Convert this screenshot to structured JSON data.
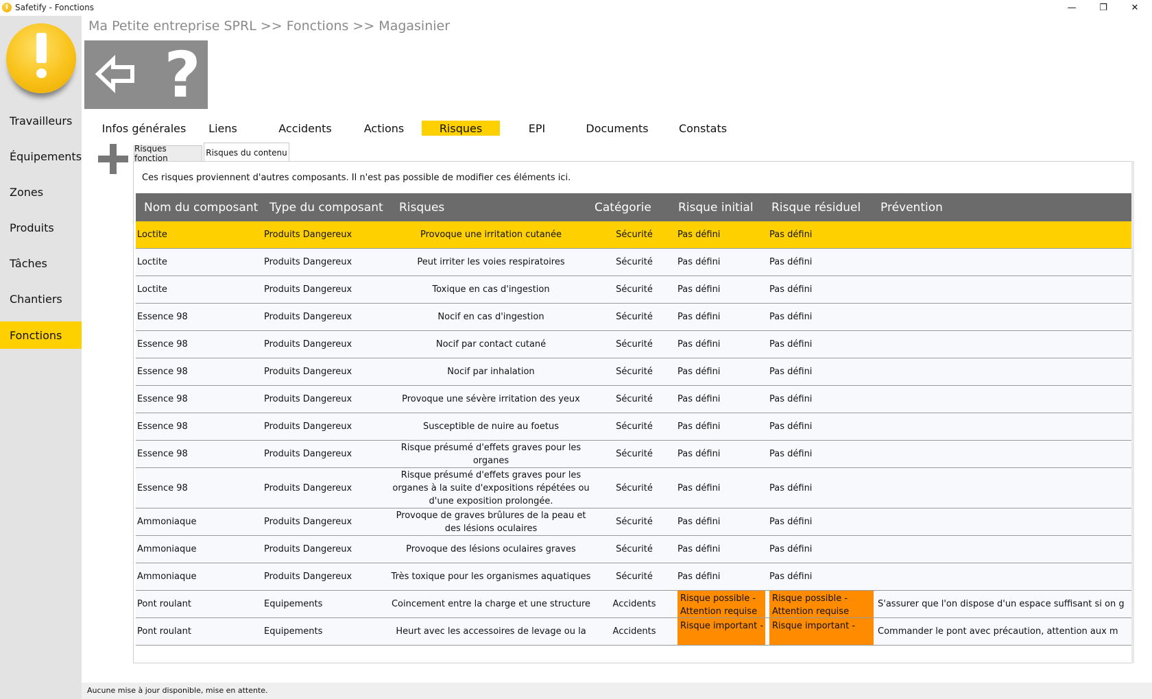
{
  "window": {
    "title": "Safetify - Fonctions",
    "minimize": "—",
    "maximize": "❐",
    "close": "✕"
  },
  "sidebar": {
    "items": [
      {
        "label": "Travailleurs",
        "active": false
      },
      {
        "label": "Équipements",
        "active": false
      },
      {
        "label": "Zones",
        "active": false
      },
      {
        "label": "Produits",
        "active": false
      },
      {
        "label": "Tâches",
        "active": false
      },
      {
        "label": "Chantiers",
        "active": false
      },
      {
        "label": "Fonctions",
        "active": true
      }
    ]
  },
  "breadcrumb": "Ma Petite entreprise SPRL >> Fonctions >> Magasinier",
  "toolbar": {
    "help_label": "?"
  },
  "tabs": [
    "Infos générales",
    "Liens",
    "Accidents",
    "Actions",
    "Risques",
    "EPI",
    "Documents",
    "Constats"
  ],
  "active_tab": "Risques",
  "subtabs": [
    "Risques fonction",
    "Risques du contenu"
  ],
  "note": "Ces risques proviennent d'autres composants. Il n'est pas possible de modifier ces éléments ici.",
  "table": {
    "headers": [
      "Nom du composant",
      "Type du composant",
      "Risques",
      "Catégorie",
      "Risque initial",
      "Risque résiduel",
      "Prévention"
    ],
    "rows": [
      [
        "Loctite",
        "Produits Dangereux",
        "Provoque une irritation cutanée",
        "Sécurité",
        "Pas défini",
        "Pas défini",
        ""
      ],
      [
        "Loctite",
        "Produits Dangereux",
        "Peut irriter les voies respiratoires",
        "Sécurité",
        "Pas défini",
        "Pas défini",
        ""
      ],
      [
        "Loctite",
        "Produits Dangereux",
        "Toxique en cas d'ingestion",
        "Sécurité",
        "Pas défini",
        "Pas défini",
        ""
      ],
      [
        "Essence 98",
        "Produits Dangereux",
        "Nocif en cas d'ingestion",
        "Sécurité",
        "Pas défini",
        "Pas défini",
        ""
      ],
      [
        "Essence 98",
        "Produits Dangereux",
        "Nocif par contact cutané",
        "Sécurité",
        "Pas défini",
        "Pas défini",
        ""
      ],
      [
        "Essence 98",
        "Produits Dangereux",
        "Nocif par inhalation",
        "Sécurité",
        "Pas défini",
        "Pas défini",
        ""
      ],
      [
        "Essence 98",
        "Produits Dangereux",
        "Provoque une sévère irritation des yeux",
        "Sécurité",
        "Pas défini",
        "Pas défini",
        ""
      ],
      [
        "Essence 98",
        "Produits Dangereux",
        "Susceptible de nuire au foetus",
        "Sécurité",
        "Pas défini",
        "Pas défini",
        ""
      ],
      [
        "Essence 98",
        "Produits Dangereux",
        "Risque présumé d'effets graves pour les organes",
        "Sécurité",
        "Pas défini",
        "Pas défini",
        ""
      ],
      [
        "Essence 98",
        "Produits Dangereux",
        "Risque présumé d'effets graves pour les organes à la suite d'expositions répétées ou d'une exposition prolongée.",
        "Sécurité",
        "Pas défini",
        "Pas défini",
        ""
      ],
      [
        "Ammoniaque",
        "Produits Dangereux",
        "Provoque de graves brûlures de la peau et des lésions oculaires",
        "Sécurité",
        "Pas défini",
        "Pas défini",
        ""
      ],
      [
        "Ammoniaque",
        "Produits Dangereux",
        "Provoque des lésions oculaires graves",
        "Sécurité",
        "Pas défini",
        "Pas défini",
        ""
      ],
      [
        "Ammoniaque",
        "Produits Dangereux",
        "Très toxique pour les organismes aquatiques",
        "Sécurité",
        "Pas défini",
        "Pas défini",
        ""
      ],
      [
        "Pont roulant",
        "Equipements",
        "Coincement entre la charge et une structure",
        "Accidents",
        "Risque possible - Attention requise",
        "Risque possible - Attention requise",
        "S'assurer que l'on dispose d'un espace suffisant si on g"
      ],
      [
        "Pont roulant",
        "Equipements",
        "Heurt avec les accessoires de levage ou la",
        "Accidents",
        "Risque important -",
        "Risque important -",
        "Commander le pont avec précaution, attention aux m"
      ]
    ],
    "selected_row": 0,
    "highlight_color": "#ffd000",
    "warning_color": "#ff8c00"
  },
  "status": "Aucune mise à jour disponible, mise en attente."
}
